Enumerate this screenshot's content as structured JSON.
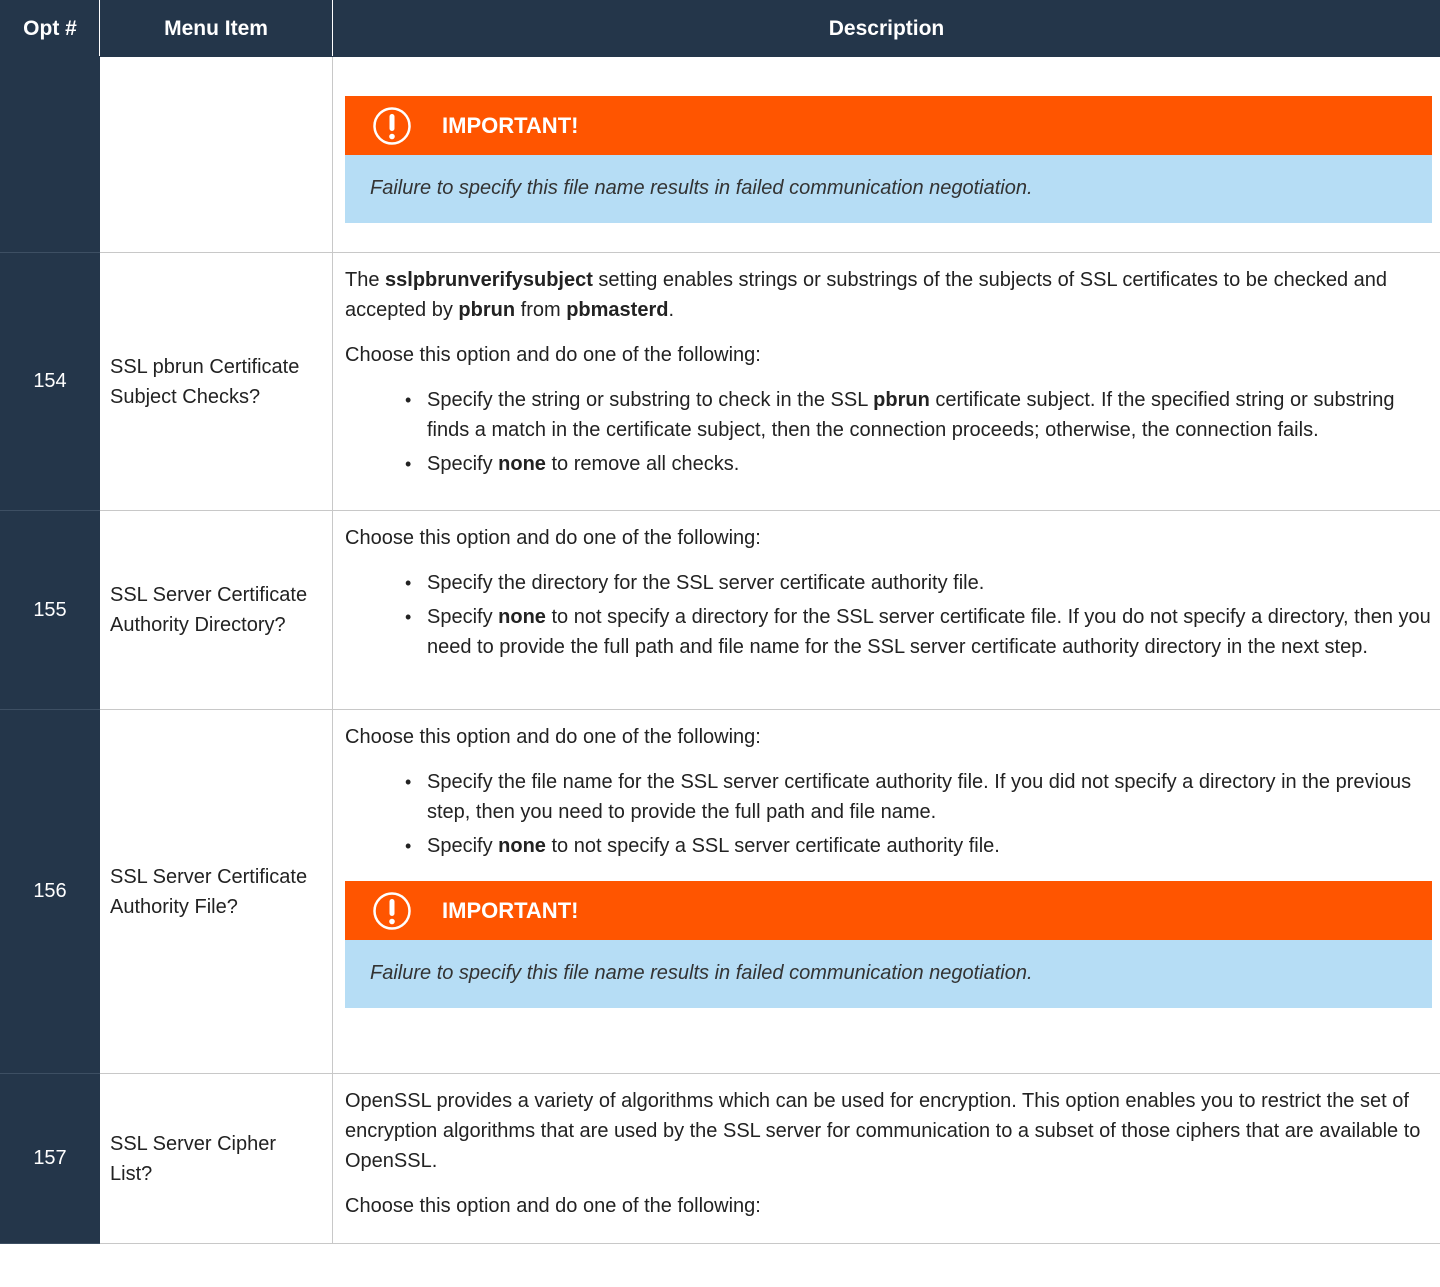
{
  "headers": {
    "opt": "Opt #",
    "menu": "Menu Item",
    "desc": "Description"
  },
  "colors": {
    "header_bg": "#24364a",
    "callout_head": "#ff5500",
    "callout_body": "#b6ddf5"
  },
  "icons": {
    "callout": "exclamation-circle-icon"
  },
  "rows": [
    {
      "opt": "",
      "menu": "",
      "callout": {
        "title": "IMPORTANT!",
        "text": "Failure to specify this file name results in failed communication negotiation."
      }
    },
    {
      "opt": "154",
      "menu": "SSL pbrun Certificate Subject Checks?",
      "p1": {
        "a": "The ",
        "b": "sslpbrunverifysubject",
        "c": " setting enables strings or substrings of the subjects of SSL certificates to be checked and accepted by ",
        "d": "pbrun",
        "e": " from ",
        "f": "pbmasterd",
        "g": "."
      },
      "p2": "Choose this option and do one of the following:",
      "b1": {
        "a": "Specify the string or substring to check in the SSL ",
        "b": "pbrun",
        "c": " certificate subject. If the specified string or substring finds a match in the certificate subject, then the connection proceeds; otherwise, the connection fails."
      },
      "b2": {
        "a": "Specify ",
        "b": "none",
        "c": " to remove all checks."
      }
    },
    {
      "opt": "155",
      "menu": "SSL Server Certificate Authority Directory?",
      "p1": "Choose this option and do one of the following:",
      "b1": "Specify the directory for the SSL server certificate authority file.",
      "b2": {
        "a": "Specify ",
        "b": "none",
        "c": " to not specify a directory for the SSL server certificate file. If you do not specify a directory, then you need to provide the full path and file name for the SSL server certificate authority directory in the next step."
      }
    },
    {
      "opt": "156",
      "menu": "SSL Server Certificate Authority File?",
      "p1": "Choose this option and do one of the following:",
      "b1": "Specify the file name for the SSL server certificate authority file. If you did not specify a directory in the previous step, then you need to provide the full path and file name.",
      "b2": {
        "a": "Specify ",
        "b": "none",
        "c": " to not specify a SSL server certificate authority file."
      },
      "callout": {
        "title": "IMPORTANT!",
        "text": "Failure to specify this file name results in failed communication negotiation."
      }
    },
    {
      "opt": "157",
      "menu": "SSL Server Cipher List?",
      "p1": "OpenSSL provides a variety of algorithms which can be used for encryption. This option enables you to restrict the set of encryption algorithms that are used by the SSL server for communication to a subset of those ciphers that are available to OpenSSL.",
      "p2": "Choose this option and do one of the following:"
    }
  ]
}
